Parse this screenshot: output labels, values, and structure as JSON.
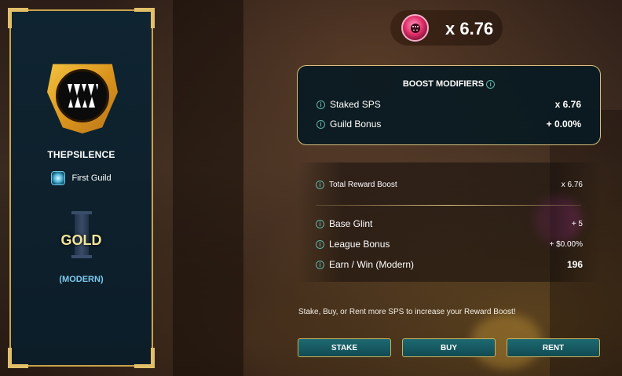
{
  "player": {
    "name": "THEPSILENCE",
    "guild": "First Guild",
    "league": "GOLD",
    "format": "(MODERN)"
  },
  "multiplier": {
    "value": "x 6.76",
    "icon": "sps-token-icon"
  },
  "boost_modifiers": {
    "title": "BOOST MODIFIERS",
    "rows": [
      {
        "label": "Staked SPS",
        "value": "x 6.76"
      },
      {
        "label": "Guild Bonus",
        "value": "+ 0.00%"
      }
    ]
  },
  "rewards": {
    "total": {
      "label": "Total Reward Boost",
      "value": "x 6.76"
    },
    "rows": [
      {
        "label": "Base Glint",
        "value": "+ 5"
      },
      {
        "label": "League Bonus",
        "value": "+ $0.00%"
      },
      {
        "label": "Earn / Win (Modern)",
        "value": "196"
      }
    ]
  },
  "promo": "Stake, Buy, or Rent more SPS to increase your Reward Boost!",
  "buttons": {
    "stake": "STAKE",
    "buy": "BUY",
    "rent": "RENT"
  },
  "colors": {
    "accent_gold": "#d8c07c",
    "league_gold": "#f2e49a",
    "format_blue": "#7fc9ee",
    "button_teal": "#1d6a72"
  }
}
